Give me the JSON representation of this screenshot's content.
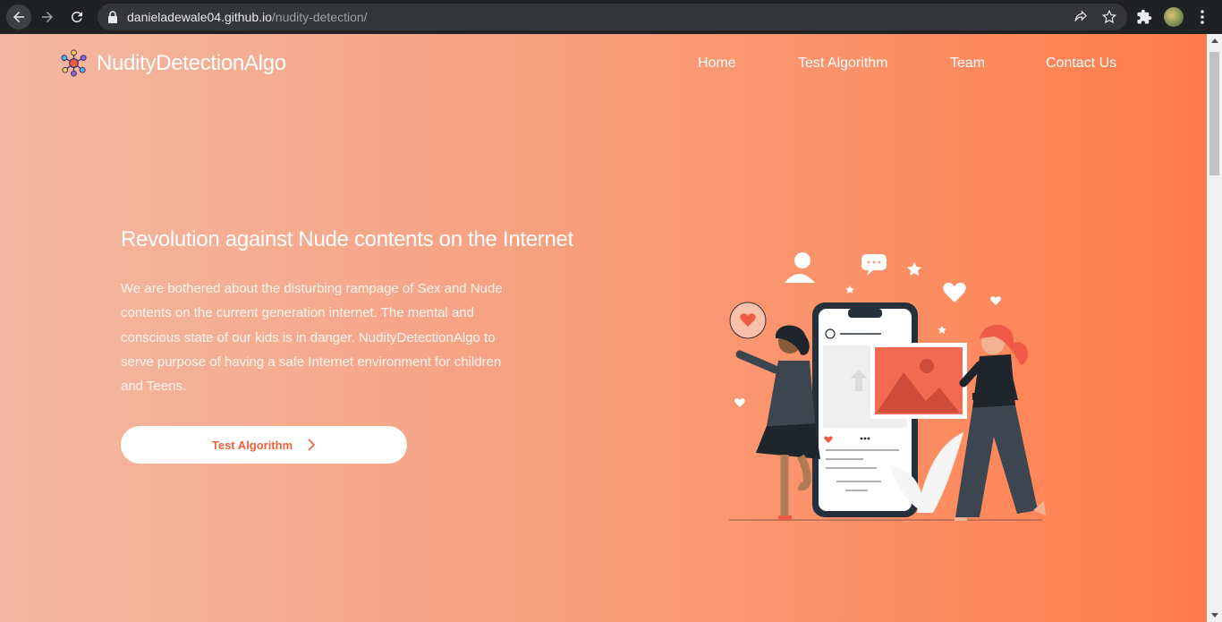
{
  "browser": {
    "url_host": "danieladewale04.github.io",
    "url_path": "/nudity-detection/"
  },
  "header": {
    "brand_name": "NudityDetectionAlgo",
    "nav": [
      {
        "label": "Home"
      },
      {
        "label": "Test Algorithm"
      },
      {
        "label": "Team"
      },
      {
        "label": "Contact Us"
      }
    ]
  },
  "hero": {
    "title": "Revolution against Nude contents on the Internet",
    "description": "We are bothered about the disturbing rampage of Sex and Nude contents on the current generation internet. The mental and conscious state of our kids is in danger. NudityDetectionAlgo to serve purpose of having a safe Internet environment for children and Teens.",
    "cta_label": "Test Algorithm"
  },
  "colors": {
    "gradient_start": "#f3b8a3",
    "gradient_end": "#ff7a4b",
    "accent": "#f0603a",
    "chrome_bg": "#202124"
  },
  "icons": [
    "back-arrow-icon",
    "forward-arrow-icon",
    "reload-icon",
    "lock-icon",
    "share-icon",
    "bookmark-star-icon",
    "extensions-icon",
    "profile-avatar",
    "menu-dots-icon",
    "logo-network-icon",
    "chevron-right-icon"
  ]
}
